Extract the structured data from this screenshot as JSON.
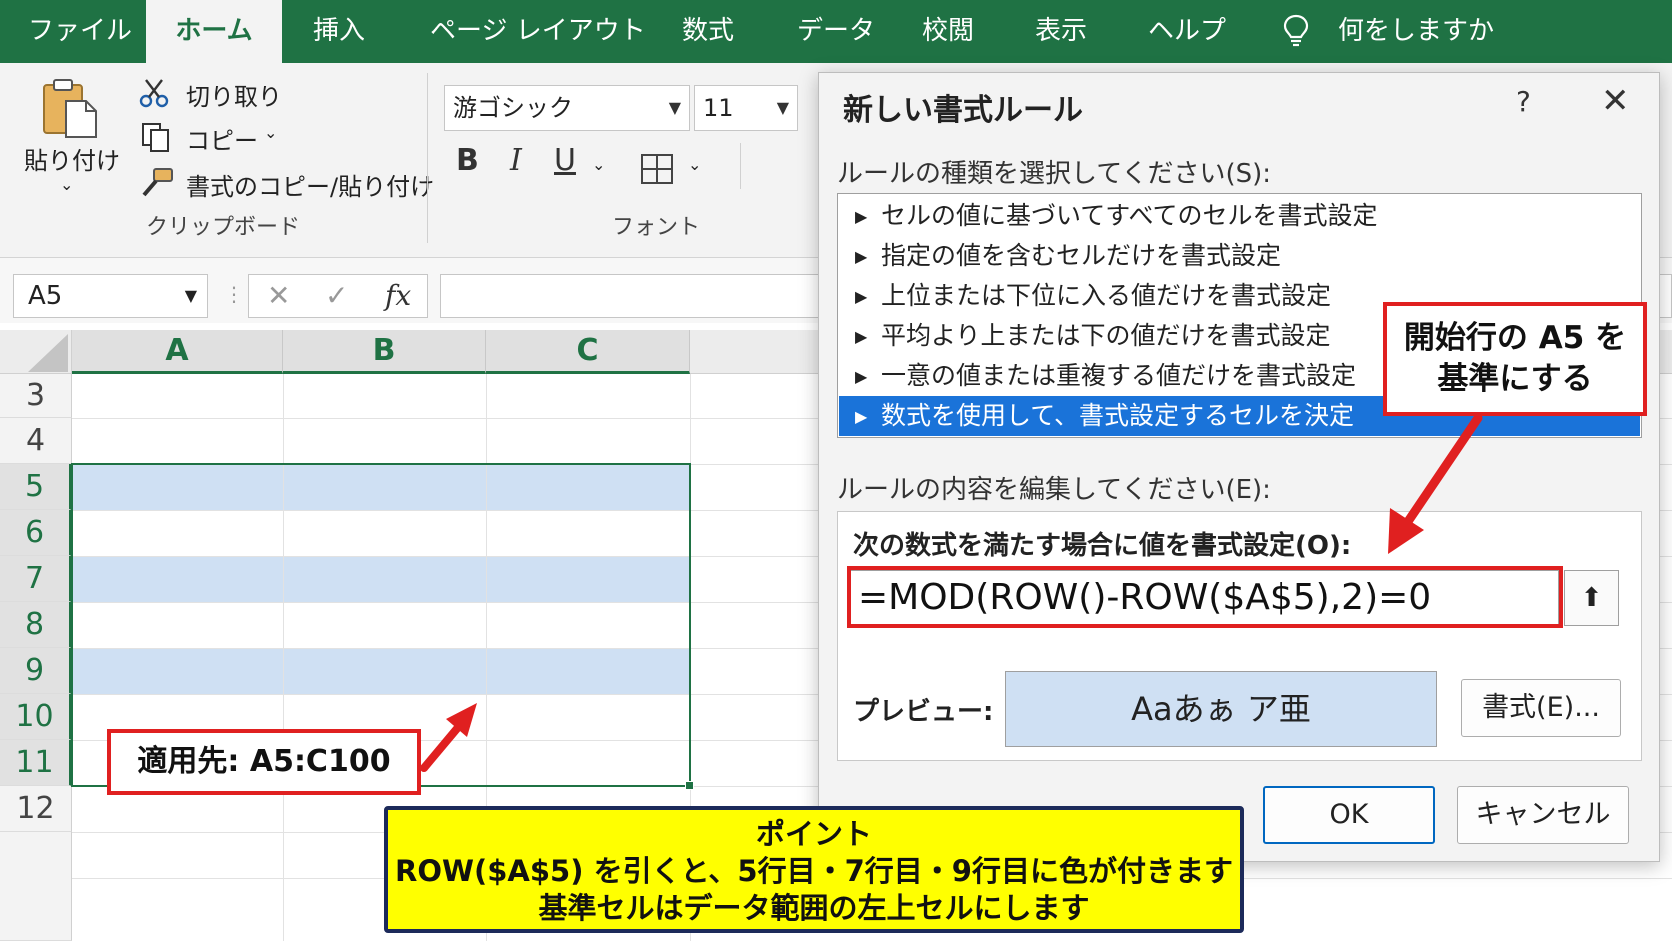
{
  "ribbon_tabs": [
    "ファイル",
    "ホーム",
    "挿入",
    "ページ レイアウト",
    "数式",
    "データ",
    "校閲",
    "表示",
    "ヘルプ"
  ],
  "tell_me": "何をしますか",
  "clipboard": {
    "paste": "貼り付け",
    "cut": "切り取り",
    "copy": "コピー",
    "format_painter": "書式のコピー/貼り付け",
    "group_label": "クリップボード"
  },
  "font": {
    "name": "游ゴシック",
    "size": "11",
    "bold": "B",
    "italic": "I",
    "underline": "U",
    "group_label": "フォント"
  },
  "formula_bar": {
    "name_box": "A5",
    "cancel": "✕",
    "enter": "✓",
    "fx": "fx"
  },
  "sheet": {
    "columns": [
      "A",
      "B",
      "C"
    ],
    "rows": [
      "3",
      "4",
      "5",
      "6",
      "7",
      "8",
      "9",
      "10",
      "11",
      "12"
    ]
  },
  "dialog": {
    "title": "新しい書式ルール",
    "help": "?",
    "close": "✕",
    "rule_type_label": "ルールの種類を選択してください(S):",
    "rule_types": [
      "セルの値に基づいてすべてのセルを書式設定",
      "指定の値を含むセルだけを書式設定",
      "上位または下位に入る値だけを書式設定",
      "平均より上または下の値だけを書式設定",
      "一意の値または重複する値だけを書式設定",
      "数式を使用して、書式設定するセルを決定"
    ],
    "selected_rule": 5,
    "edit_label": "ルールの内容を編集してください(E):",
    "formula_label": "次の数式を満たす場合に値を書式設定(O):",
    "formula": "=MOD(ROW()-ROW($A$5),2)=0",
    "collapse_icon": "⬆",
    "preview_label": "プレビュー:",
    "preview_text": "Aaあぁ ア亜",
    "format_button": "書式(E)...",
    "ok": "OK",
    "cancel": "キャンセル"
  },
  "annotations": {
    "apply_to": "適用先: A5:C100",
    "start_row_line1": "開始行の A5 を",
    "start_row_line2": "基準にする",
    "note_title": "ポイント",
    "note_line1": "ROW($A$5) を引くと、5行目・7行目・9行目に色が付きます",
    "note_line2": "基準セルはデータ範囲の左上セルにします"
  },
  "colors": {
    "excel_green": "#1f7244",
    "band_fill": "#cfe0f3",
    "selection_blue": "#1a73d9",
    "annotation_red": "#e02020",
    "note_yellow": "#ffff00"
  }
}
